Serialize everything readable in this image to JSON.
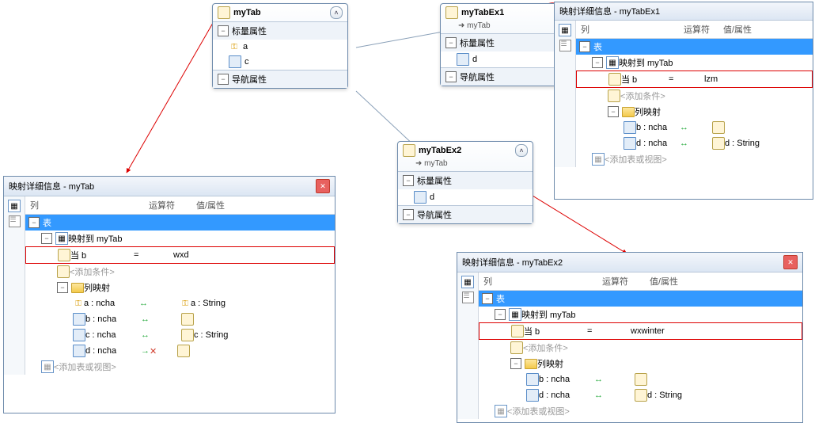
{
  "e1": {
    "title": "myTab",
    "sec1": "标量属性",
    "a": "a",
    "c": "c",
    "sec2": "导航属性"
  },
  "e2": {
    "title": "myTabEx1",
    "sub": "➜ myTab",
    "sec1": "标量属性",
    "d": "d",
    "sec2": "导航属性"
  },
  "e3": {
    "title": "myTabEx2",
    "sub": "➜ myTab",
    "sec1": "标量属性",
    "d": "d",
    "sec2": "导航属性"
  },
  "d1": {
    "title": "映射详细信息 - myTab",
    "h1": "列",
    "h2": "运算符",
    "h3": "值/属性",
    "table": "表",
    "map": "映射到 myTab",
    "cond_field": "当 b",
    "cond_op": "=",
    "cond_val": "wxd",
    "addcond": "<添加条件>",
    "colmap": "列映射",
    "r1a": "a : ncha",
    "r1c": "a : String",
    "r2a": "b : ncha",
    "r3a": "c : ncha",
    "r3c": "c : String",
    "r4a": "d : ncha",
    "addtbl": "<添加表或视图>"
  },
  "d2": {
    "title": "映射详细信息 - myTabEx1",
    "h1": "列",
    "h2": "运算符",
    "h3": "值/属性",
    "table": "表",
    "map": "映射到 myTab",
    "cond_field": "当 b",
    "cond_op": "=",
    "cond_val": "lzm",
    "addcond": "<添加条件>",
    "colmap": "列映射",
    "r1a": "b : ncha",
    "r2a": "d : ncha",
    "r2c": "d : String",
    "addtbl": "<添加表或视图>"
  },
  "d3": {
    "title": "映射详细信息 - myTabEx2",
    "h1": "列",
    "h2": "运算符",
    "h3": "值/属性",
    "table": "表",
    "map": "映射到 myTab",
    "cond_field": "当 b",
    "cond_op": "=",
    "cond_val": "wxwinter",
    "addcond": "<添加条件>",
    "colmap": "列映射",
    "r1a": "b : ncha",
    "r2a": "d : ncha",
    "r2c": "d : String",
    "addtbl": "<添加表或视图>"
  }
}
